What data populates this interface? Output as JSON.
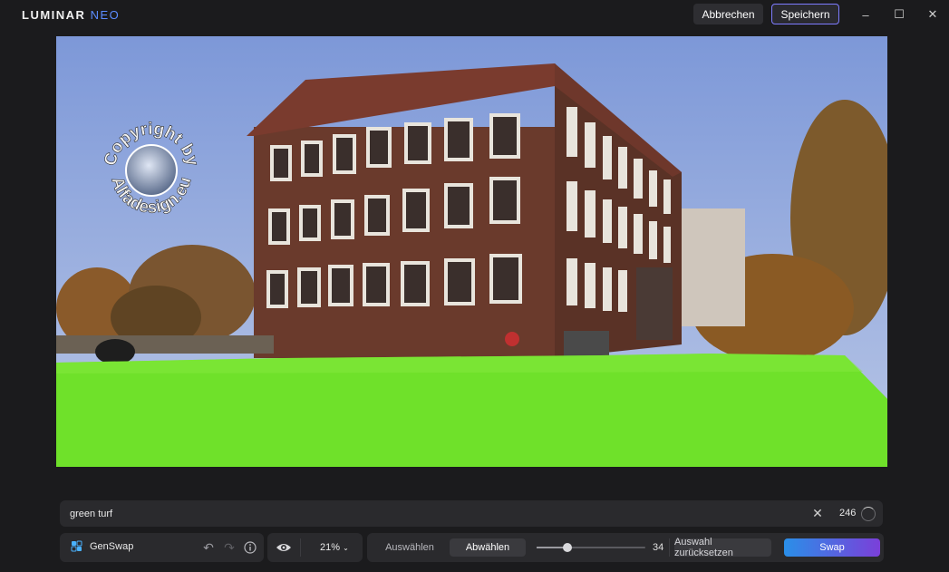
{
  "app": {
    "logo_main": "LUMINAR",
    "logo_sub": "NEO"
  },
  "titlebar": {
    "cancel_label": "Abbrechen",
    "save_label": "Speichern",
    "minimize_icon": "minimize-icon",
    "maximize_icon": "maximize-icon",
    "close_icon": "close-icon"
  },
  "photo": {
    "watermark_top": "Copyright by",
    "watermark_bottom": "Alfadesign.eu"
  },
  "prompt": {
    "value": "green turf",
    "clear_icon": "clear-icon",
    "count": "246"
  },
  "tool": {
    "name": "GenSwap",
    "undo_icon": "undo-icon",
    "redo_icon": "redo-icon",
    "info_icon": "info-icon"
  },
  "view": {
    "eye_icon": "eye-icon",
    "zoom": "21%"
  },
  "mask": {
    "select_label": "Auswählen",
    "deselect_label": "Abwählen",
    "active": "deselect",
    "brush_size": "34",
    "brush_fraction": 0.28,
    "reset_label": "Auswahl zurücksetzen",
    "swap_label": "Swap"
  },
  "colors": {
    "accent": "#7e7cff",
    "swap_gradient_start": "#2a8fe8",
    "swap_gradient_end": "#7b3fd9",
    "turf_green": "#6fe12a"
  }
}
